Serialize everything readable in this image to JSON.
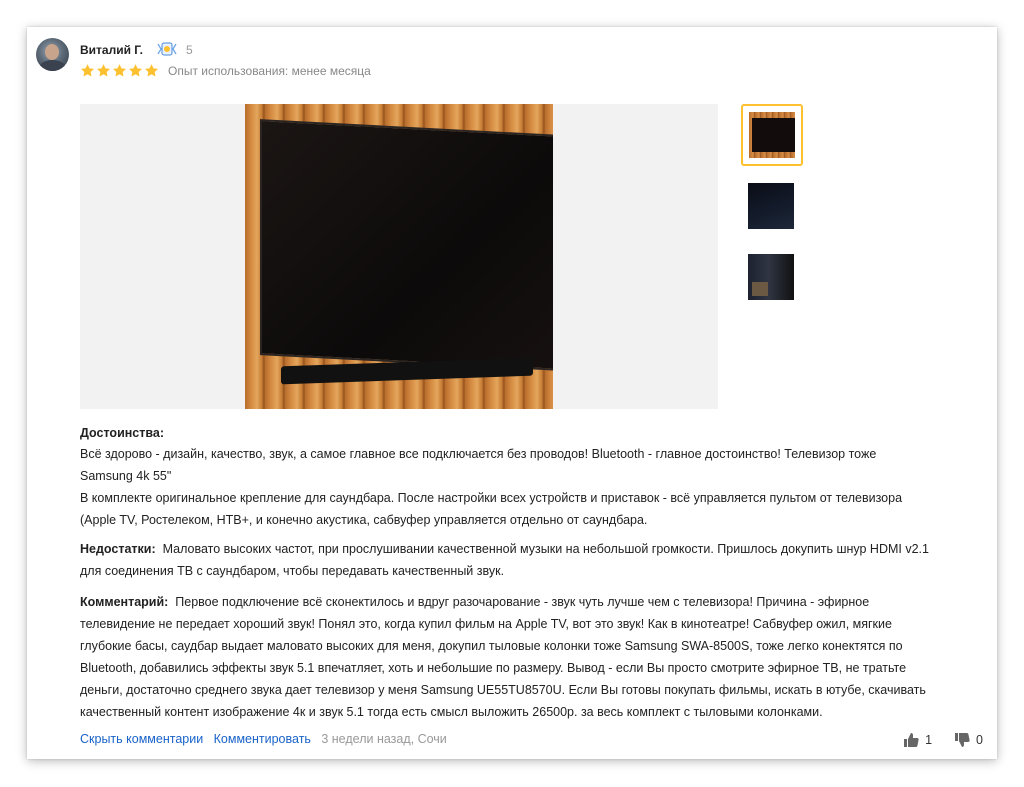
{
  "review": {
    "author": "Виталий Г.",
    "badge_count": "5",
    "rating": 5,
    "experience": "Опыт использования: менее месяца",
    "pros_title": "Достоинства:",
    "pros_line1": "Всё здорово - дизайн, качество, звук, а самое главное все подключается без проводов! Bluetooth - главное достоинство! Телевизор тоже",
    "pros_line2": "Samsung 4k 55\"",
    "pros_line3": "В комплекте оригинальное крепление для саундбара. После настройки всех устройств и приставок - всё управляется пультом от телевизора",
    "pros_line4": "(Apple TV, Ростелеком, НТВ+, и конечно акустика, сабвуфер управляется отдельно от саундбара.",
    "cons_title": "Недостатки:",
    "cons_line1": "Маловато высоких частот, при прослушивании качественной музыки на небольшой громкости. Пришлось докупить шнур HDMI v2.1",
    "cons_line2": "для соединения ТВ с саундбаром, чтобы передавать качественный звук.",
    "comment_title": "Комментарий:",
    "comment_line1": "Первое подключение всё сконектилось и вдруг разочарование - звук чуть лучше чем с телевизора! Причина - эфирное",
    "comment_line2": "телевидение не передает хороший звук! Понял это, когда купил фильм на Apple TV, вот это звук! Как в кинотеатре! Сабвуфер ожил, мягкие",
    "comment_line3": "глубокие басы, саудбар выдает маловато высоких для меня, докупил тыловые колонки тоже Samsung SWA-8500S, тоже легко конектятся по",
    "comment_line4": "Bluetooth, добавились эффекты звук 5.1 впечатляет, хоть и небольшие по размеру. Вывод - если Вы просто смотрите эфирное ТВ, не тратьте",
    "comment_line5": "деньги, достаточно среднего звука дает телевизор у меня Samsung UE55TU8570U. Если Вы готовы покупать фильмы, искать в ютубе, скачивать",
    "comment_line6": "качественный контент изображение 4к и звук 5.1 тогда есть смысл выложить 26500р. за весь комплект с тыловыми колонками."
  },
  "footer": {
    "hide_comments": "Скрыть комментарии",
    "comment": "Комментировать",
    "meta": "3 недели назад, Сочи",
    "likes": "1",
    "dislikes": "0"
  },
  "colors": {
    "star": "#fdc02f",
    "link": "#1a63c9",
    "thumb_selected": "#fdc02f"
  },
  "icons": [
    "avatar",
    "achievement-badge-icon",
    "star-icon",
    "thumbs-up-icon",
    "thumbs-down-icon"
  ]
}
